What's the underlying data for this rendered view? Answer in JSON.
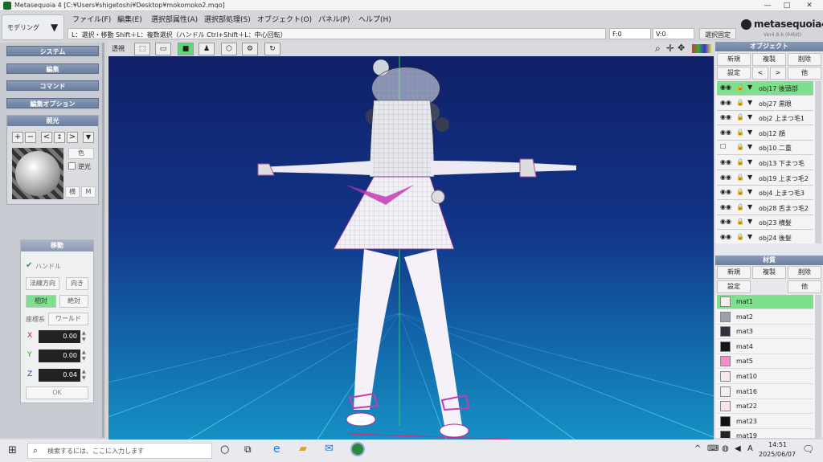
{
  "titlebar": {
    "title": "Metasequoia 4 [C:¥Users¥shigetoshi¥Desktop¥mokomoko2.mqo]",
    "minimize": "—",
    "maximize": "□",
    "close": "✕"
  },
  "mode": {
    "label": "モデリング",
    "arrow": "▼"
  },
  "menu": [
    "ファイル(F)",
    "編集(E)",
    "選択部属性(A)",
    "選択部処理(S)",
    "オブジェクト(O)",
    "パネル(P)",
    "ヘルプ(H)"
  ],
  "status": {
    "hint": "L：選択・移動  Shift＋L：複数選択（ハンドル  Ctrl+Shift＋L：中心回転）",
    "face": "F:0",
    "vertex": "V:0",
    "fix": "選択固定"
  },
  "logo": {
    "name": "metasequoia4",
    "version": "Ver4.8.6 (64bit)"
  },
  "left": {
    "buttons": [
      "システム",
      "編集",
      "コマンド",
      "編集オプション"
    ],
    "light": {
      "title": "照光",
      "tools": [
        "+",
        "−",
        "<",
        "↕",
        ">",
        "▼"
      ],
      "color_label": "色",
      "reverse_label": "逆光",
      "horizontal_label": "横",
      "m_label": "M"
    }
  },
  "move": {
    "title": "移動",
    "handle_label": "ハンドル",
    "normal_btn": "法線方向",
    "direction_btn": "向き",
    "relative_btn": "相対",
    "absolute_btn": "絶対",
    "coord_label": "座標系",
    "world_btn": "ワールド",
    "x_label": "X",
    "x_value": "0.00",
    "y_label": "Y",
    "y_value": "0.00",
    "z_label": "Z",
    "z_value": "0.04",
    "ok": "OK"
  },
  "viewtools": {
    "persp": "透視",
    "icons": [
      "zoom-icon",
      "move-icon",
      "rotate-icon"
    ]
  },
  "objects": {
    "title": "オブジェクト",
    "new": "新規",
    "copy": "複製",
    "delete": "削除",
    "settings": "設定",
    "prev": "<",
    "next": ">",
    "other": "他",
    "items": [
      {
        "name": "obj17  後頭部",
        "selected": true,
        "visible": true
      },
      {
        "name": "obj27  黒眼",
        "selected": false,
        "visible": true
      },
      {
        "name": "obj2  上まつ毛1",
        "selected": false,
        "visible": true
      },
      {
        "name": "obj12  顔",
        "selected": false,
        "visible": true
      },
      {
        "name": "obj10  二重",
        "selected": false,
        "visible": false
      },
      {
        "name": "obj13  下まつ毛",
        "selected": false,
        "visible": true
      },
      {
        "name": "obj19  上まつ毛2",
        "selected": false,
        "visible": true
      },
      {
        "name": "obj4  上まつ毛3",
        "selected": false,
        "visible": true
      },
      {
        "name": "obj28  舌まつ毛2",
        "selected": false,
        "visible": true
      },
      {
        "name": "obj23  横髪",
        "selected": false,
        "visible": true
      },
      {
        "name": "obj24  後髪",
        "selected": false,
        "visible": true
      }
    ]
  },
  "materials": {
    "title": "材質",
    "new": "新規",
    "copy": "複製",
    "delete": "削除",
    "settings": "設定",
    "other": "他",
    "items": [
      {
        "name": "mat1",
        "color": "#f4eef0",
        "selected": true
      },
      {
        "name": "mat2",
        "color": "#9aa0ac",
        "selected": false
      },
      {
        "name": "mat3",
        "color": "#2e3242",
        "selected": false
      },
      {
        "name": "mat4",
        "color": "#16161a",
        "selected": false
      },
      {
        "name": "mat5",
        "color": "#ee8ec4",
        "selected": false
      },
      {
        "name": "mat10",
        "color": "#f8e6ea",
        "selected": false
      },
      {
        "name": "mat16",
        "color": "#f6f0ec",
        "selected": false
      },
      {
        "name": "mat22",
        "color": "#f8e4e8",
        "selected": false
      },
      {
        "name": "mat23",
        "color": "#101014",
        "selected": false
      },
      {
        "name": "mat19",
        "color": "#222226",
        "selected": false
      }
    ]
  },
  "taskbar": {
    "search_placeholder": "検索するには、ここに入力します",
    "time": "14:51",
    "date": "2025/06/07",
    "ime": "A"
  }
}
